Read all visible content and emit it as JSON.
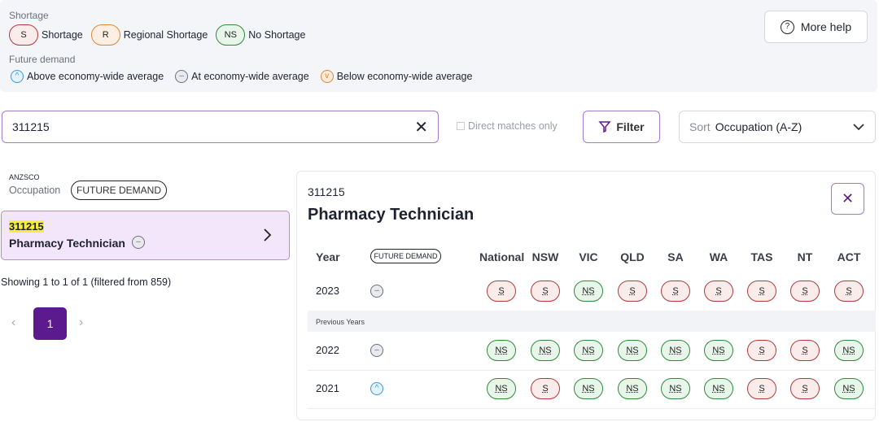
{
  "legend": {
    "shortage_title": "Shortage",
    "items": [
      {
        "code": "S",
        "label": "Shortage"
      },
      {
        "code": "R",
        "label": "Regional Shortage"
      },
      {
        "code": "NS",
        "label": "No Shortage"
      }
    ],
    "future_title": "Future demand",
    "demand": [
      {
        "icon": "chevron-up-icon",
        "label": "Above economy-wide average"
      },
      {
        "icon": "minus-icon",
        "label": "At economy-wide average"
      },
      {
        "icon": "chevron-down-icon",
        "label": "Below economy-wide average"
      }
    ]
  },
  "help": {
    "label": "More help",
    "icon": "question-circle-icon"
  },
  "search": {
    "value": "311215"
  },
  "direct_matches": "Direct matches only",
  "filter": {
    "label": "Filter",
    "icon": "filter-icon"
  },
  "sort": {
    "prefix": "Sort",
    "value": "Occupation (A-Z)"
  },
  "list": {
    "anzsco": "ANZSCO",
    "occupation": "Occupation",
    "future_demand": "FUTURE DEMAND",
    "card": {
      "code": "311215",
      "name": "Pharmacy Technician",
      "demand": "at"
    },
    "showing": "Showing 1 to 1 of 1 (filtered from 859)",
    "page": "1"
  },
  "detail": {
    "code": "311215",
    "title": "Pharmacy Technician",
    "year_header": "Year",
    "demand_header": "FUTURE DEMAND",
    "columns": [
      "National",
      "NSW",
      "VIC",
      "QLD",
      "SA",
      "WA",
      "TAS",
      "NT",
      "ACT"
    ],
    "previous_label": "Previous Years",
    "rows": [
      {
        "year": "2023",
        "demand": "at",
        "values": [
          "S",
          "S",
          "NS",
          "S",
          "S",
          "S",
          "S",
          "S",
          "S"
        ]
      },
      {
        "year": "2022",
        "demand": "at",
        "values": [
          "NS",
          "NS",
          "NS",
          "NS",
          "NS",
          "NS",
          "S",
          "S",
          "NS"
        ]
      },
      {
        "year": "2021",
        "demand": "above",
        "values": [
          "NS",
          "S",
          "NS",
          "NS",
          "NS",
          "NS",
          "S",
          "S",
          "NS"
        ]
      }
    ]
  },
  "colors": {
    "accent": "#5b1a8e",
    "shortage": "#b23a3a",
    "regional": "#d9893a",
    "no_shortage": "#2f8a3d",
    "highlight": "#f5ef3a"
  }
}
